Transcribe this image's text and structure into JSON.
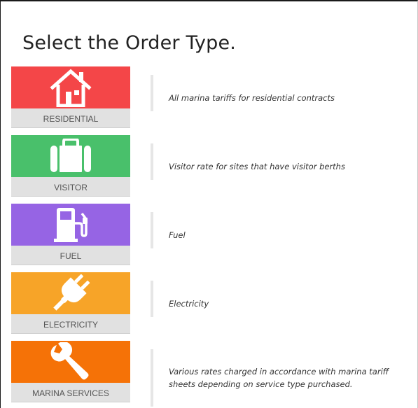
{
  "page": {
    "title": "Select the Order Type."
  },
  "order_types": [
    {
      "label": "RESIDENTIAL",
      "description": "All marina tariffs for residential contracts",
      "color": "#f44648",
      "icon": "house-icon"
    },
    {
      "label": "VISITOR",
      "description": "Visitor rate for sites that have visitor berths",
      "color": "#49c06b",
      "icon": "suitcase-icon"
    },
    {
      "label": "FUEL",
      "description": "Fuel",
      "color": "#9664e4",
      "icon": "fuel-pump-icon"
    },
    {
      "label": "ELECTRICITY",
      "description": "Electricity",
      "color": "#f7a428",
      "icon": "plug-icon"
    },
    {
      "label": "MARINA SERVICES",
      "description": "Various rates charged in accordance with marina tariff sheets depending on service type purchased.",
      "color": "#f57207",
      "icon": "wrench-icon"
    }
  ]
}
